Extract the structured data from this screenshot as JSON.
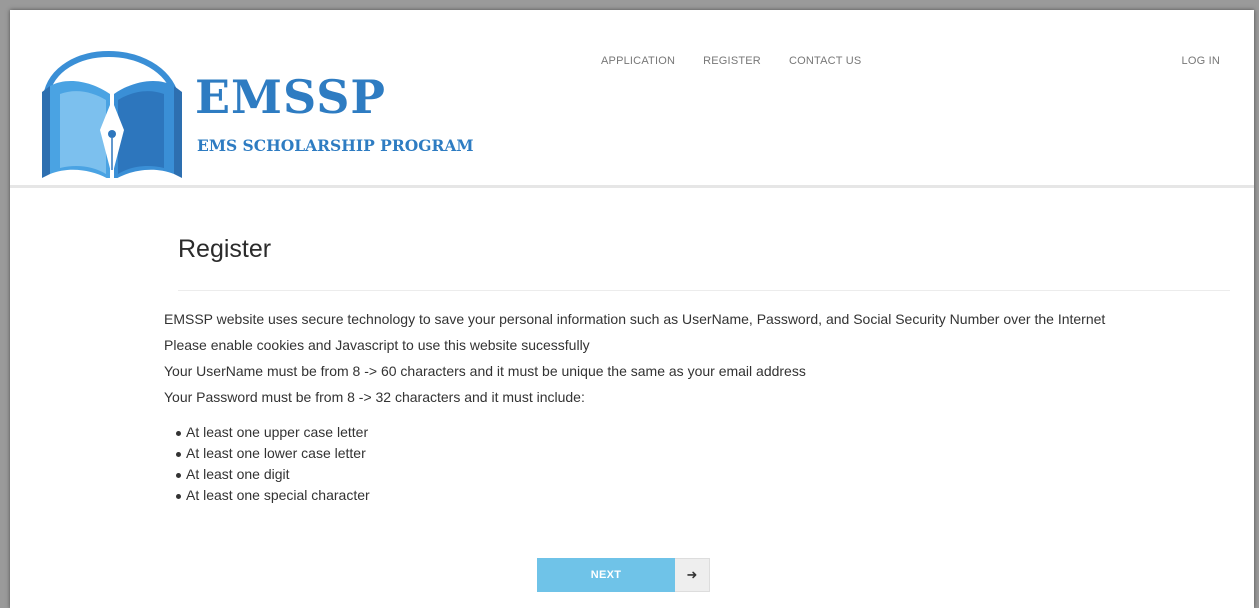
{
  "brand": {
    "title": "EMSSP",
    "subtitle": "EMS SCHOLARSHIP PROGRAM",
    "color": "#2e7cc2"
  },
  "nav": {
    "items": [
      {
        "label": "APPLICATION"
      },
      {
        "label": "REGISTER"
      },
      {
        "label": "CONTACT US"
      }
    ],
    "login": "LOG IN"
  },
  "main": {
    "title": "Register",
    "intro": [
      "EMSSP website uses secure technology to save your personal information such as UserName, Password, and Social Security Number over the Internet",
      "Please enable cookies and Javascript to use this website sucessfully",
      "Your UserName must be from 8 -> 60 characters and it must be unique the same as your email address",
      "Your Password must be from 8 -> 32 characters and it must include:"
    ],
    "requirements": [
      "At least one upper case letter",
      "At least one lower case letter",
      "At least one digit",
      "At least one special character"
    ],
    "next_label": "NEXT",
    "next_icon": "arrow-right-icon",
    "next_color": "#6fc3e8"
  }
}
